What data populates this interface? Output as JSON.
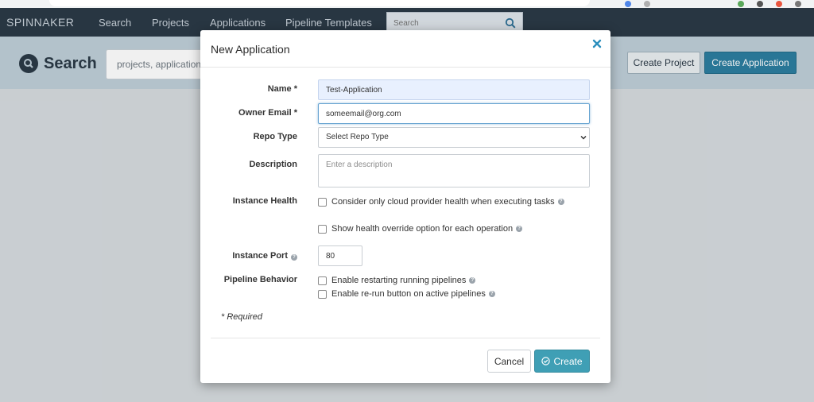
{
  "nav": {
    "brand": "SPINNAKER",
    "links": [
      "Search",
      "Projects",
      "Applications",
      "Pipeline Templates"
    ],
    "search_placeholder": "Search"
  },
  "page": {
    "title": "Search",
    "search_placeholder": "projects, applications",
    "create_project_label": "Create Project",
    "create_application_label": "Create Application"
  },
  "modal": {
    "title": "New Application",
    "fields": {
      "name_label": "Name *",
      "name_value": "Test-Application",
      "owner_email_label": "Owner Email *",
      "owner_email_value": "someemail@org.com",
      "repo_type_label": "Repo Type",
      "repo_type_value": "Select Repo Type",
      "description_label": "Description",
      "description_placeholder": "Enter a description",
      "instance_health_label": "Instance Health",
      "health_option_1": "Consider only cloud provider health when executing tasks",
      "health_option_2": "Show health override option for each operation",
      "instance_port_label": "Instance Port",
      "instance_port_value": "80",
      "pipeline_behavior_label": "Pipeline Behavior",
      "pipeline_option_1": "Enable restarting running pipelines",
      "pipeline_option_2": "Enable re-run button on active pipelines"
    },
    "required_note": "* Required",
    "cancel_label": "Cancel",
    "create_label": "Create"
  },
  "colors": {
    "nav_bg": "#2b3a47",
    "header_bg": "#bfcfd8",
    "primary": "#2c7ea0",
    "create_button": "#3f9fb5",
    "close_icon": "#2c8fbd"
  }
}
